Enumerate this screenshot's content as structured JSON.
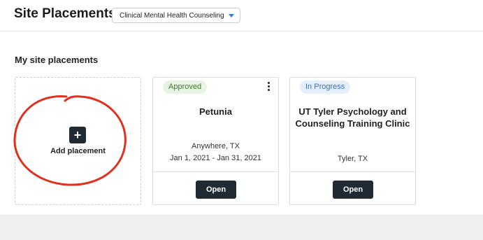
{
  "header": {
    "title": "Site Placements",
    "program_select": {
      "value": "Clinical Mental Health Counseling"
    }
  },
  "section": {
    "heading": "My site placements"
  },
  "add_card": {
    "plus_glyph": "+",
    "label": "Add placement"
  },
  "placements": [
    {
      "status": "Approved",
      "name": "Petunia",
      "location": "Anywhere, TX",
      "dates": "Jan 1, 2021 - Jan 31, 2021",
      "open_label": "Open"
    },
    {
      "status": "In Progress",
      "name": "UT Tyler Psychology and Counseling Training Clinic",
      "location": "Tyler, TX",
      "open_label": "Open"
    }
  ],
  "colors": {
    "approved_badge_bg": "#e6f4e1",
    "approved_badge_text": "#3e7d2c",
    "in_progress_badge_bg": "#e4effb",
    "in_progress_badge_text": "#3873b7",
    "primary_button": "#1f2a33",
    "annotation_red": "#e0301e"
  }
}
